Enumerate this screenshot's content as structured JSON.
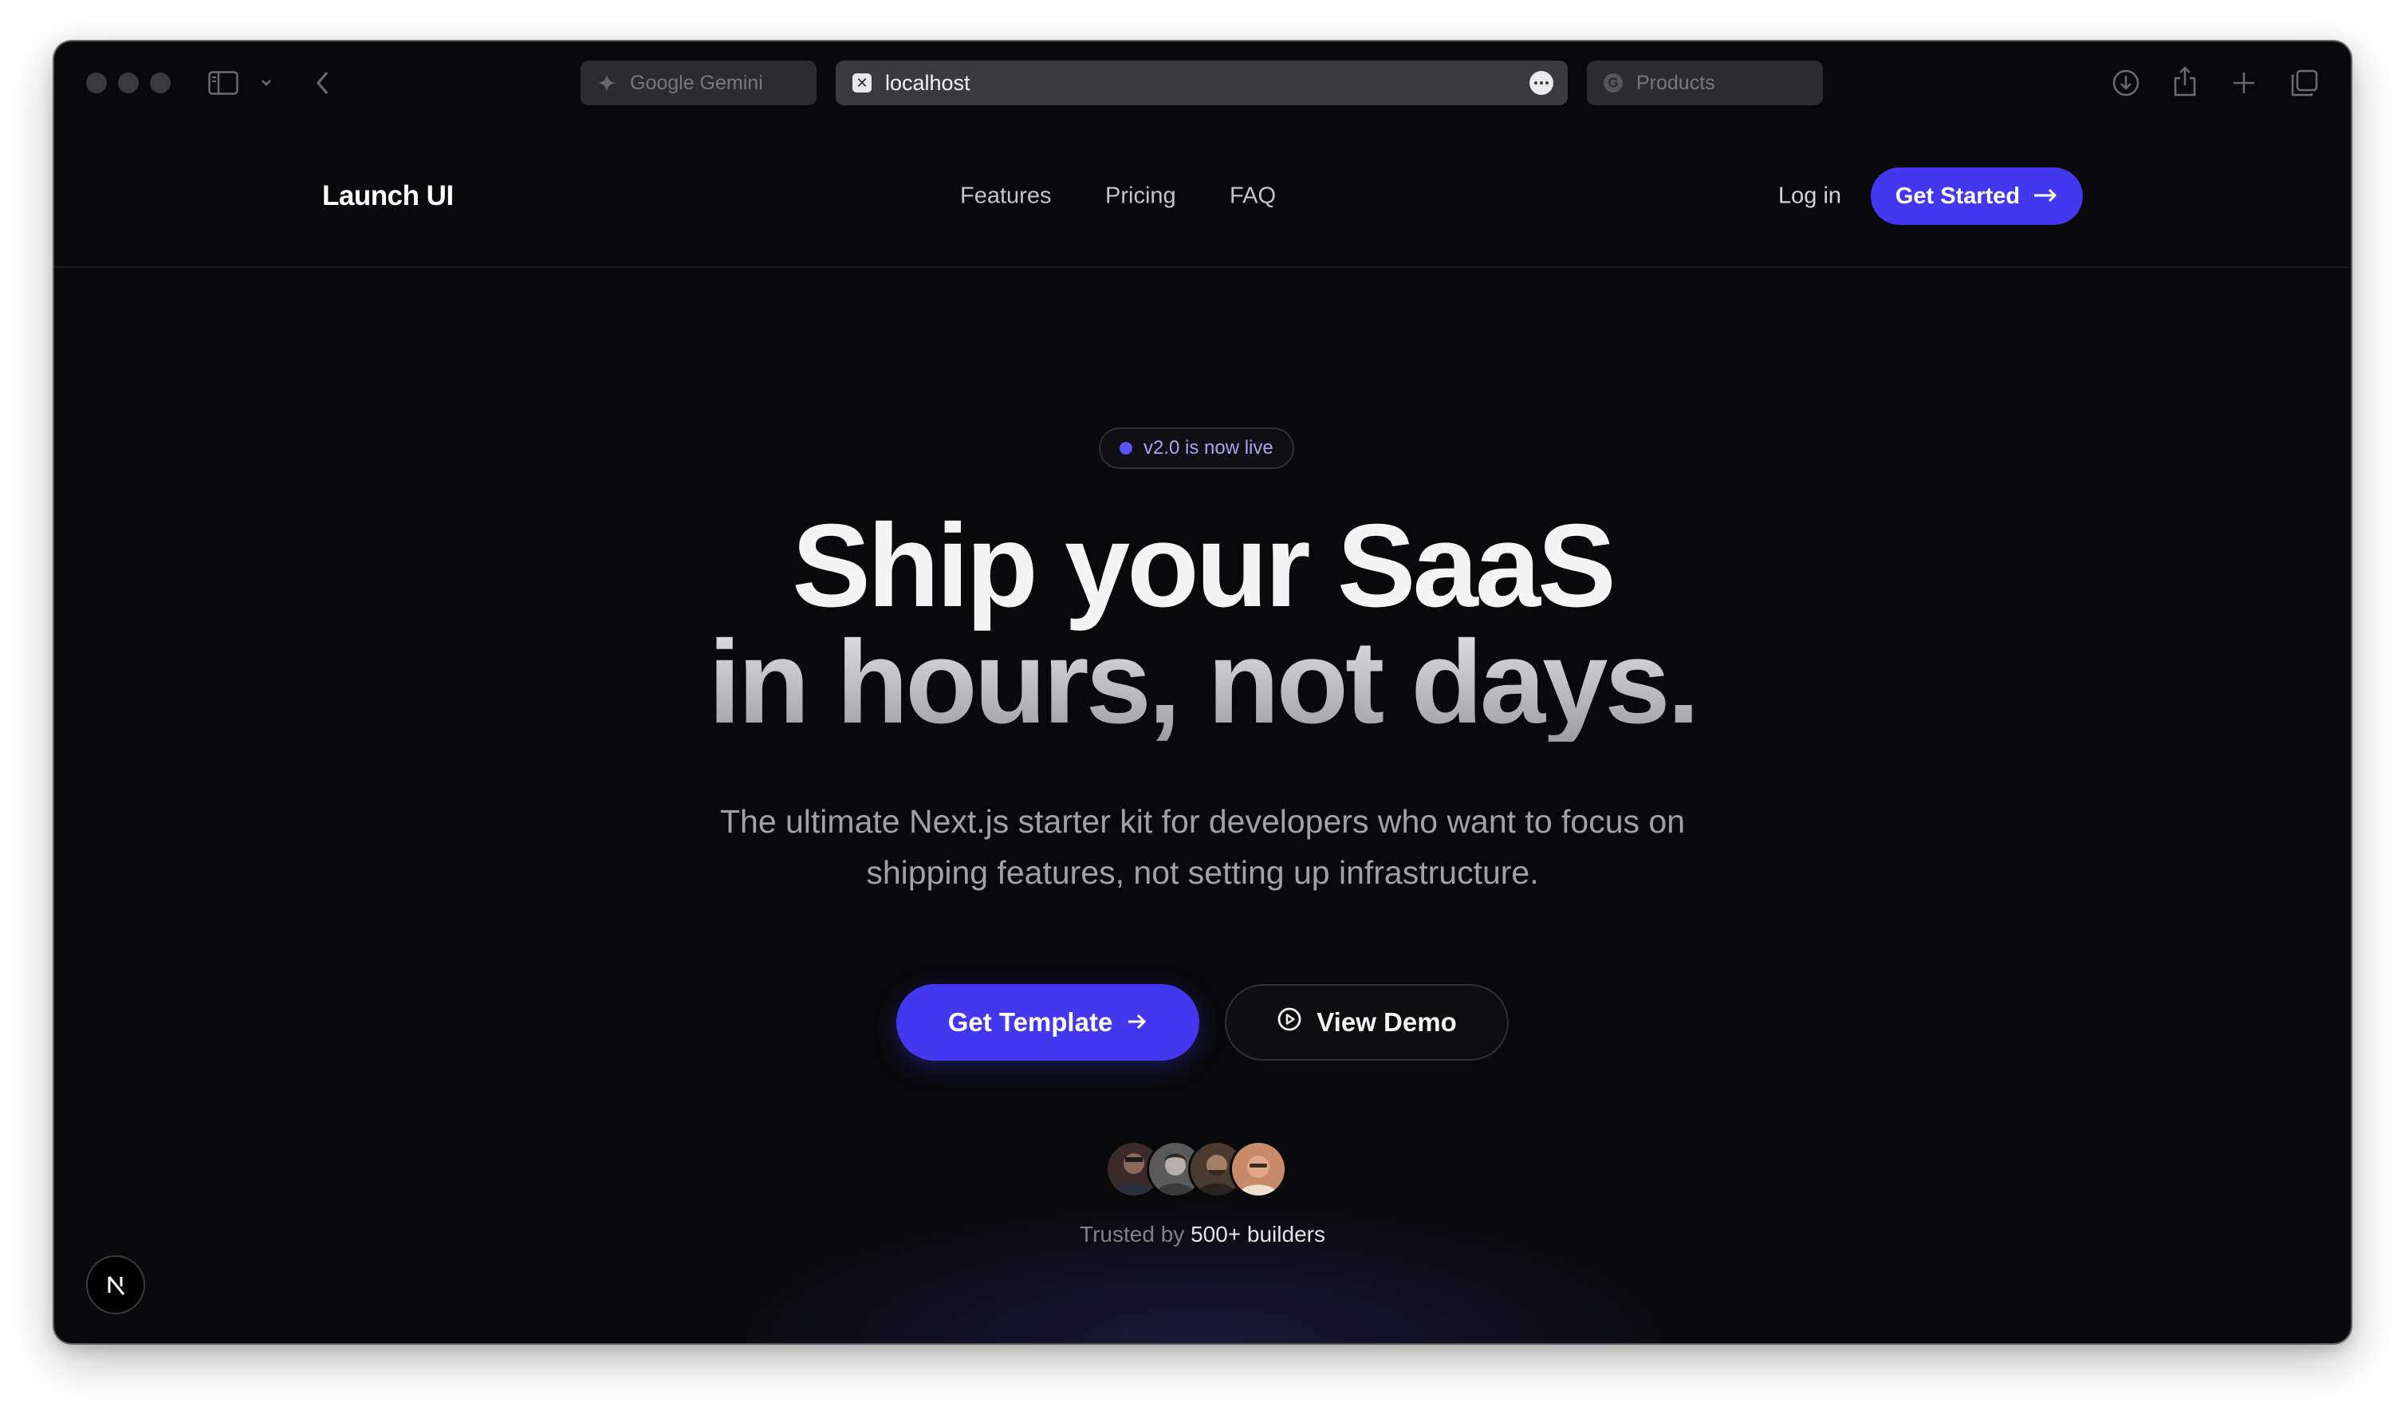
{
  "browser": {
    "tabs": [
      {
        "label": "Google Gemini",
        "icon": "sparkle-icon"
      },
      {
        "label": "localhost",
        "icon": "x-favicon-icon"
      },
      {
        "label": "Products",
        "icon": "g-favicon-icon"
      }
    ]
  },
  "site": {
    "brand": "Launch UI",
    "nav": {
      "features": "Features",
      "pricing": "Pricing",
      "faq": "FAQ",
      "login": "Log in",
      "cta": "Get Started"
    }
  },
  "hero": {
    "badge": "v2.0 is now live",
    "headline_line1": "Ship your SaaS",
    "headline_line2": "in hours, not days.",
    "subtext_line1": "The ultimate Next.js starter kit for developers who want to focus on",
    "subtext_line2": "shipping features, not setting up infrastructure.",
    "primary_cta": "Get Template",
    "secondary_cta": "View Demo",
    "trusted_prefix": "Trusted by",
    "trusted_count": "500+ builders"
  },
  "colors": {
    "accent": "#4338f0",
    "background": "#09090b",
    "badge_dot": "#5b52f6"
  }
}
